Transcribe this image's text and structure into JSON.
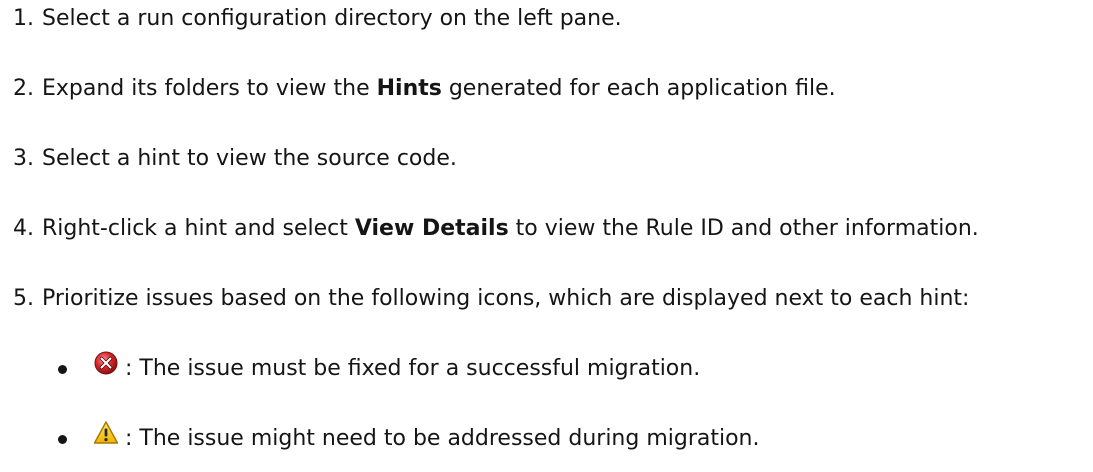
{
  "steps": [
    {
      "num": "1.",
      "before": "Select a run configuration directory on the left pane.",
      "bold": "",
      "after": ""
    },
    {
      "num": "2.",
      "before": "Expand its folders to view the ",
      "bold": "Hints",
      "after": " generated for each application file."
    },
    {
      "num": "3.",
      "before": "Select a hint to view the source code.",
      "bold": "",
      "after": ""
    },
    {
      "num": "4.",
      "before": "Right-click a hint and select ",
      "bold": "View Details",
      "after": " to view the Rule ID and other information."
    },
    {
      "num": "5.",
      "before": "Prioritize issues based on the following icons, which are displayed next to each hint:",
      "bold": "",
      "after": ""
    }
  ],
  "bullets": [
    {
      "icon": "error-icon",
      "text": ": The issue must be fixed for a successful migration.",
      "color": "#d7262b"
    },
    {
      "icon": "warning-icon",
      "text": ": The issue might need to be addressed during migration.",
      "color": "#f5c400"
    }
  ]
}
